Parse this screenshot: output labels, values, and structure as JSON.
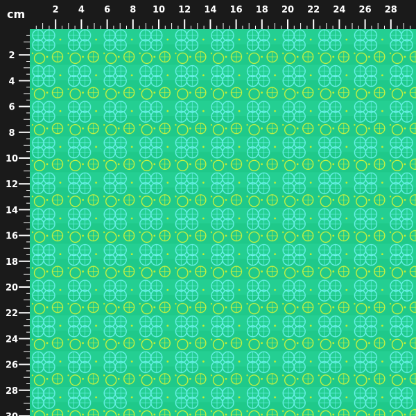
{
  "ruler": {
    "unit": "cm",
    "top_labels": [
      "2",
      "4",
      "6",
      "8",
      "10",
      "12",
      "14",
      "16",
      "18",
      "20",
      "22",
      "24",
      "26",
      "28"
    ],
    "left_labels": [
      "2",
      "4",
      "6",
      "8",
      "10",
      "12",
      "14",
      "16",
      "18",
      "20",
      "22",
      "24",
      "26",
      "28",
      "30"
    ]
  },
  "fabric": {
    "description_colors": {
      "background": "#1fc98a",
      "light_band": "#2fd69b",
      "cyan_motif": "#5ff0e8",
      "yellow_motif": "#c8f23a"
    }
  }
}
